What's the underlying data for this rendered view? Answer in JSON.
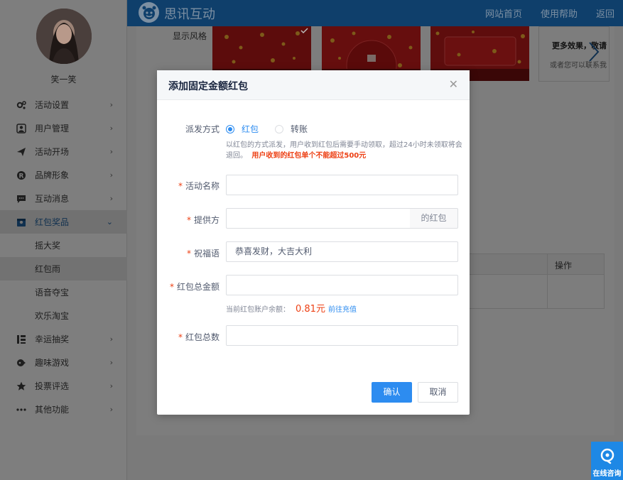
{
  "user": {
    "name": "笑一笑"
  },
  "sidebar": {
    "items": [
      {
        "label": "活动设置",
        "icon": "gears-icon"
      },
      {
        "label": "用户管理",
        "icon": "user-icon"
      },
      {
        "label": "活动开场",
        "icon": "paper-plane-icon"
      },
      {
        "label": "品牌形象",
        "icon": "registered-icon"
      },
      {
        "label": "互动消息",
        "icon": "message-icon"
      },
      {
        "label": "红包奖品",
        "icon": "gift-icon",
        "active": true,
        "children": [
          {
            "label": "摇大奖"
          },
          {
            "label": "红包雨",
            "active": true
          },
          {
            "label": "语音夺宝"
          },
          {
            "label": "欢乐淘宝"
          }
        ]
      },
      {
        "label": "幸运抽奖",
        "icon": "lottery-icon"
      },
      {
        "label": "趣味游戏",
        "icon": "gamepad-icon"
      },
      {
        "label": "投票评选",
        "icon": "star-icon"
      },
      {
        "label": "其他功能",
        "icon": "more-icon"
      }
    ]
  },
  "topbar": {
    "brand": "思讯互动",
    "links": [
      "网站首页",
      "使用帮助",
      "返回"
    ]
  },
  "page": {
    "style_label": "显示风格",
    "more_title": "更多效果，敬请",
    "more_sub": "或者您可以联系我",
    "table_operation_header": "操作"
  },
  "modal": {
    "title": "添加固定金额红包",
    "dispatch": {
      "label": "派发方式",
      "options": [
        "红包",
        "转账"
      ],
      "selected": "红包",
      "help_line1": "以红包的方式派发，用户收到红包后需要手动领取，超过24小时未领取将会",
      "help_line2": "退回。",
      "help_warning": "用户收到的红包单个不能超过500元"
    },
    "activity_name": {
      "label": "活动名称",
      "value": "",
      "placeholder": ""
    },
    "provider": {
      "label": "提供方",
      "value": "",
      "suffix": "的红包"
    },
    "greeting": {
      "label": "祝福语",
      "value": "恭喜发财，大吉大利"
    },
    "total_amount": {
      "label": "红包总金额",
      "value": "",
      "balance_label": "当前红包账户余额：",
      "balance_value": "0.81元",
      "recharge_link": "前往充值"
    },
    "total_count": {
      "label": "红包总数",
      "value": ""
    },
    "confirm_label": "确认",
    "cancel_label": "取消"
  },
  "chat": {
    "label": "在线咨询"
  },
  "colors": {
    "primary": "#2d8cf0",
    "danger": "#ed4014",
    "topbar": "#1a73c8"
  }
}
